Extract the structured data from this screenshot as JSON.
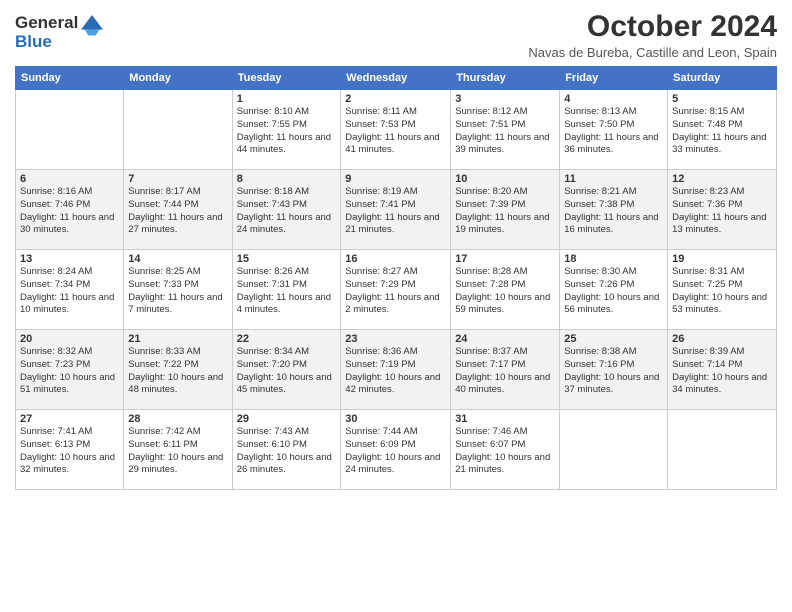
{
  "logo": {
    "general": "General",
    "blue": "Blue"
  },
  "title": "October 2024",
  "location": "Navas de Bureba, Castille and Leon, Spain",
  "days_header": [
    "Sunday",
    "Monday",
    "Tuesday",
    "Wednesday",
    "Thursday",
    "Friday",
    "Saturday"
  ],
  "weeks": [
    [
      {
        "day": "",
        "info": ""
      },
      {
        "day": "",
        "info": ""
      },
      {
        "day": "1",
        "info": "Sunrise: 8:10 AM\nSunset: 7:55 PM\nDaylight: 11 hours and 44 minutes."
      },
      {
        "day": "2",
        "info": "Sunrise: 8:11 AM\nSunset: 7:53 PM\nDaylight: 11 hours and 41 minutes."
      },
      {
        "day": "3",
        "info": "Sunrise: 8:12 AM\nSunset: 7:51 PM\nDaylight: 11 hours and 39 minutes."
      },
      {
        "day": "4",
        "info": "Sunrise: 8:13 AM\nSunset: 7:50 PM\nDaylight: 11 hours and 36 minutes."
      },
      {
        "day": "5",
        "info": "Sunrise: 8:15 AM\nSunset: 7:48 PM\nDaylight: 11 hours and 33 minutes."
      }
    ],
    [
      {
        "day": "6",
        "info": "Sunrise: 8:16 AM\nSunset: 7:46 PM\nDaylight: 11 hours and 30 minutes."
      },
      {
        "day": "7",
        "info": "Sunrise: 8:17 AM\nSunset: 7:44 PM\nDaylight: 11 hours and 27 minutes."
      },
      {
        "day": "8",
        "info": "Sunrise: 8:18 AM\nSunset: 7:43 PM\nDaylight: 11 hours and 24 minutes."
      },
      {
        "day": "9",
        "info": "Sunrise: 8:19 AM\nSunset: 7:41 PM\nDaylight: 11 hours and 21 minutes."
      },
      {
        "day": "10",
        "info": "Sunrise: 8:20 AM\nSunset: 7:39 PM\nDaylight: 11 hours and 19 minutes."
      },
      {
        "day": "11",
        "info": "Sunrise: 8:21 AM\nSunset: 7:38 PM\nDaylight: 11 hours and 16 minutes."
      },
      {
        "day": "12",
        "info": "Sunrise: 8:23 AM\nSunset: 7:36 PM\nDaylight: 11 hours and 13 minutes."
      }
    ],
    [
      {
        "day": "13",
        "info": "Sunrise: 8:24 AM\nSunset: 7:34 PM\nDaylight: 11 hours and 10 minutes."
      },
      {
        "day": "14",
        "info": "Sunrise: 8:25 AM\nSunset: 7:33 PM\nDaylight: 11 hours and 7 minutes."
      },
      {
        "day": "15",
        "info": "Sunrise: 8:26 AM\nSunset: 7:31 PM\nDaylight: 11 hours and 4 minutes."
      },
      {
        "day": "16",
        "info": "Sunrise: 8:27 AM\nSunset: 7:29 PM\nDaylight: 11 hours and 2 minutes."
      },
      {
        "day": "17",
        "info": "Sunrise: 8:28 AM\nSunset: 7:28 PM\nDaylight: 10 hours and 59 minutes."
      },
      {
        "day": "18",
        "info": "Sunrise: 8:30 AM\nSunset: 7:26 PM\nDaylight: 10 hours and 56 minutes."
      },
      {
        "day": "19",
        "info": "Sunrise: 8:31 AM\nSunset: 7:25 PM\nDaylight: 10 hours and 53 minutes."
      }
    ],
    [
      {
        "day": "20",
        "info": "Sunrise: 8:32 AM\nSunset: 7:23 PM\nDaylight: 10 hours and 51 minutes."
      },
      {
        "day": "21",
        "info": "Sunrise: 8:33 AM\nSunset: 7:22 PM\nDaylight: 10 hours and 48 minutes."
      },
      {
        "day": "22",
        "info": "Sunrise: 8:34 AM\nSunset: 7:20 PM\nDaylight: 10 hours and 45 minutes."
      },
      {
        "day": "23",
        "info": "Sunrise: 8:36 AM\nSunset: 7:19 PM\nDaylight: 10 hours and 42 minutes."
      },
      {
        "day": "24",
        "info": "Sunrise: 8:37 AM\nSunset: 7:17 PM\nDaylight: 10 hours and 40 minutes."
      },
      {
        "day": "25",
        "info": "Sunrise: 8:38 AM\nSunset: 7:16 PM\nDaylight: 10 hours and 37 minutes."
      },
      {
        "day": "26",
        "info": "Sunrise: 8:39 AM\nSunset: 7:14 PM\nDaylight: 10 hours and 34 minutes."
      }
    ],
    [
      {
        "day": "27",
        "info": "Sunrise: 7:41 AM\nSunset: 6:13 PM\nDaylight: 10 hours and 32 minutes."
      },
      {
        "day": "28",
        "info": "Sunrise: 7:42 AM\nSunset: 6:11 PM\nDaylight: 10 hours and 29 minutes."
      },
      {
        "day": "29",
        "info": "Sunrise: 7:43 AM\nSunset: 6:10 PM\nDaylight: 10 hours and 26 minutes."
      },
      {
        "day": "30",
        "info": "Sunrise: 7:44 AM\nSunset: 6:09 PM\nDaylight: 10 hours and 24 minutes."
      },
      {
        "day": "31",
        "info": "Sunrise: 7:46 AM\nSunset: 6:07 PM\nDaylight: 10 hours and 21 minutes."
      },
      {
        "day": "",
        "info": ""
      },
      {
        "day": "",
        "info": ""
      }
    ]
  ]
}
